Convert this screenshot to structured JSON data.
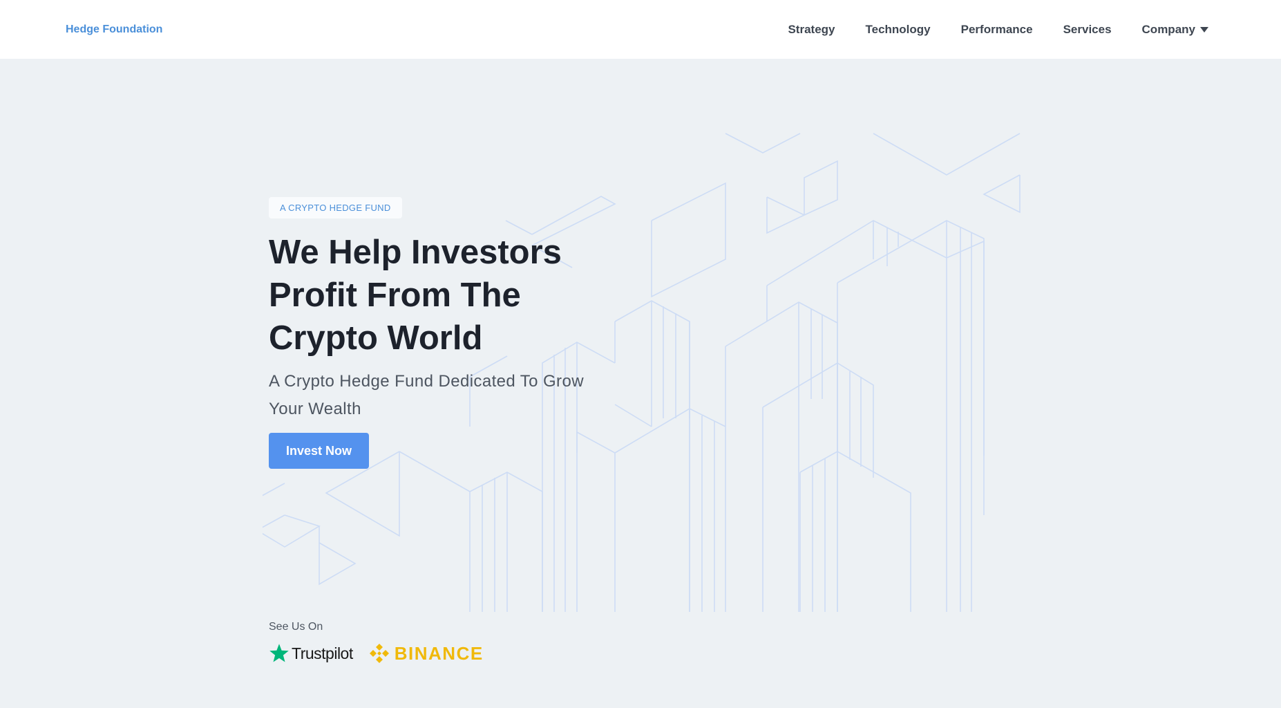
{
  "colors": {
    "brand": "#4a8fd9",
    "accent": "#5492ee",
    "background": "#edf1f4",
    "heading": "#1d222c",
    "trustpilot_green": "#00b67a",
    "binance_yellow": "#f0b90b"
  },
  "header": {
    "brand": "Hedge Foundation",
    "nav": [
      {
        "label": "Strategy"
      },
      {
        "label": "Technology"
      },
      {
        "label": "Performance"
      },
      {
        "label": "Services"
      },
      {
        "label": "Company",
        "icon": "caret-down-icon"
      }
    ]
  },
  "hero": {
    "eyebrow": "A CRYPTO HEDGE FUND",
    "headline": "We Help Investors Profit From The Crypto World",
    "subhead": "A Crypto Hedge Fund Dedicated To Grow Your Wealth",
    "cta_label": "Invest Now"
  },
  "partners": {
    "label": "See Us On",
    "logos": [
      {
        "name": "Trustpilot",
        "icon": "trustpilot-star-icon"
      },
      {
        "name": "BINANCE",
        "icon": "binance-diamond-icon"
      }
    ]
  }
}
